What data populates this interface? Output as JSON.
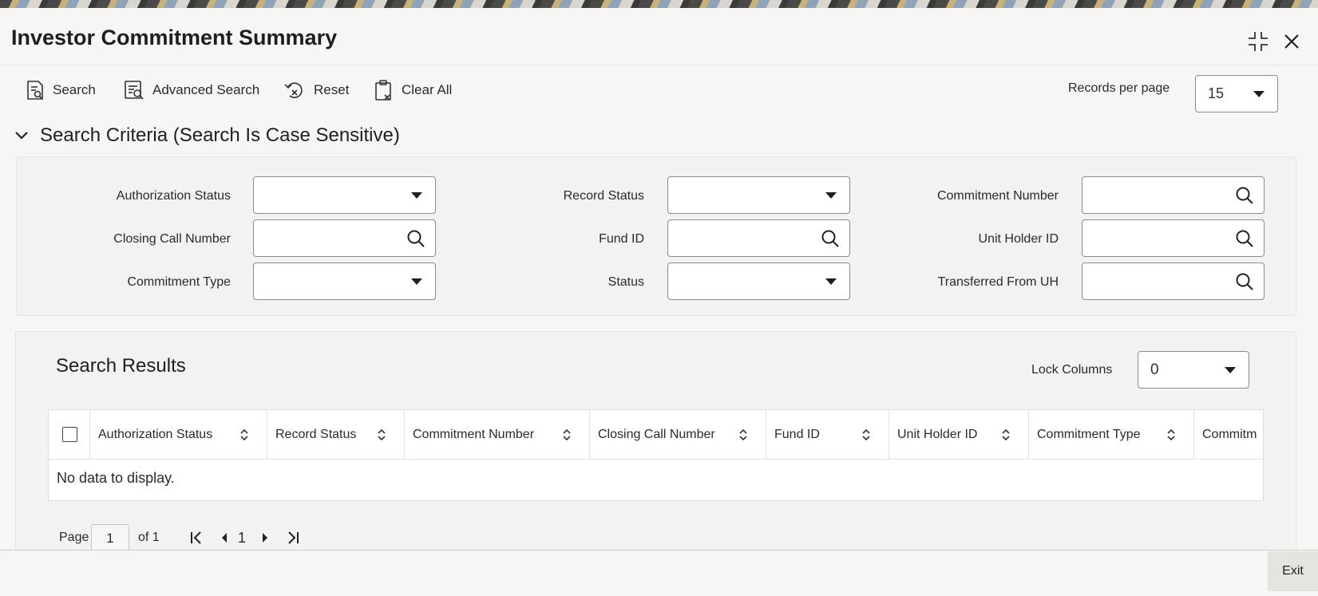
{
  "header": {
    "title": "Investor Commitment Summary"
  },
  "toolbar": {
    "search_label": "Search",
    "advanced_search_label": "Advanced Search",
    "reset_label": "Reset",
    "clear_all_label": "Clear All",
    "records_per_page_label": "Records per page",
    "records_per_page_value": "15"
  },
  "criteria": {
    "title": "Search Criteria (Search Is Case Sensitive)",
    "fields": {
      "authorization_status": "Authorization Status",
      "record_status": "Record Status",
      "commitment_number": "Commitment Number",
      "closing_call_number": "Closing Call Number",
      "fund_id": "Fund ID",
      "unit_holder_id": "Unit Holder ID",
      "commitment_type": "Commitment Type",
      "status": "Status",
      "transferred_from_uh": "Transferred From UH"
    }
  },
  "results": {
    "title": "Search Results",
    "lock_columns_label": "Lock Columns",
    "lock_columns_value": "0",
    "columns": [
      "Authorization Status",
      "Record Status",
      "Commitment Number",
      "Closing Call Number",
      "Fund ID",
      "Unit Holder ID",
      "Commitment Type",
      "Commitm"
    ],
    "empty_message": "No data to display."
  },
  "pager": {
    "page_label": "Page",
    "page_value": "1",
    "of_label": "of 1",
    "current": "1"
  },
  "footer": {
    "exit_label": "Exit"
  }
}
